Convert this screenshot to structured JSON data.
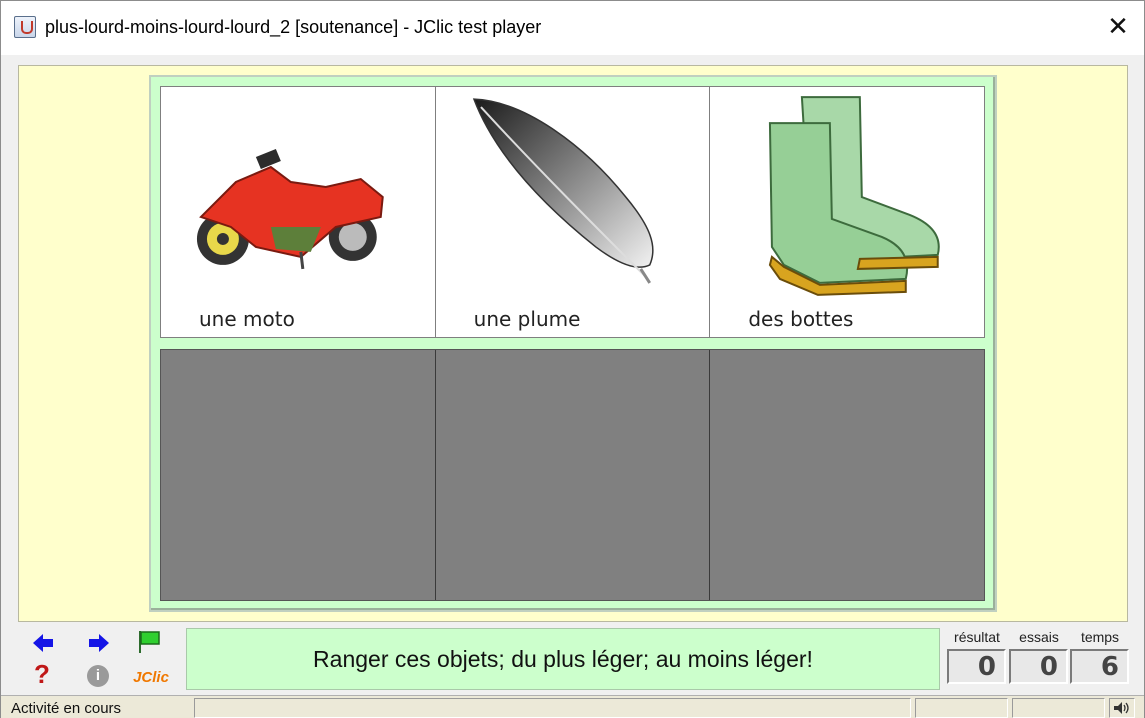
{
  "window": {
    "title": "plus-lourd-moins-lourd-lourd_2 [soutenance] - JClic test player",
    "close_glyph": "✕"
  },
  "board": {
    "top_cells": [
      {
        "label": "une moto",
        "icon": "motorcycle-icon"
      },
      {
        "label": "une plume",
        "icon": "feather-icon"
      },
      {
        "label": "des bottes",
        "icon": "boots-icon"
      }
    ],
    "bottom_cells": [
      {
        "label": ""
      },
      {
        "label": ""
      },
      {
        "label": ""
      }
    ]
  },
  "controls": {
    "prev_icon": "arrow-left-icon",
    "next_icon": "arrow-right-icon",
    "restart_icon": "flag-icon",
    "help_icon": "question-icon",
    "help_glyph": "?",
    "info_icon": "info-icon",
    "info_glyph": "i",
    "jclic_label": "JClic"
  },
  "message": "Ranger ces objets; du plus léger; au moins léger!",
  "counters": {
    "result_label": "résultat",
    "result_value": "0",
    "tries_label": "essais",
    "tries_value": "0",
    "time_label": "temps",
    "time_value": "6"
  },
  "status": {
    "text": "Activité en cours",
    "sound_icon": "speaker-icon"
  },
  "colors": {
    "activity_bg": "#ffffcc",
    "board_bg": "#ccffcc",
    "empty_cell": "#808080",
    "arrow": "#1515e6",
    "help": "#c01818",
    "jclic": "#f07800"
  }
}
